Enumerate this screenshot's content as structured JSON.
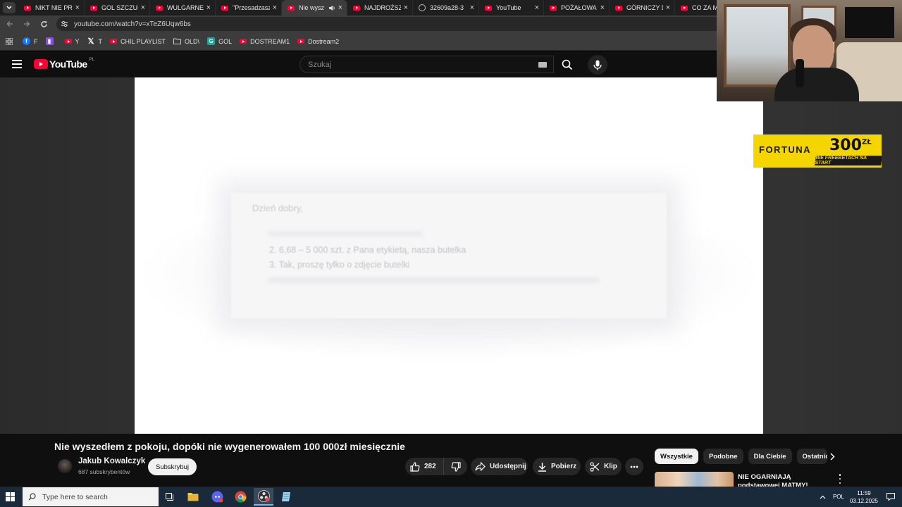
{
  "browser": {
    "tabs": [
      {
        "title": "NIKT NIE PRZ",
        "favicon": "youtube",
        "active": false
      },
      {
        "title": "GOL SZCZUR",
        "favicon": "youtube",
        "active": false
      },
      {
        "title": "WULGARNE",
        "favicon": "youtube",
        "active": false
      },
      {
        "title": "\"Przesadzasz",
        "favicon": "youtube",
        "active": false
      },
      {
        "title": "Nie wysz",
        "favicon": "youtube",
        "active": true
      },
      {
        "title": "NAJDROŻSZ",
        "favicon": "youtube",
        "active": false
      },
      {
        "title": "32609a28-3",
        "favicon": "globe",
        "active": false
      },
      {
        "title": "YouTube",
        "favicon": "youtube",
        "active": false
      },
      {
        "title": "POŻAŁOWA",
        "favicon": "youtube",
        "active": false
      },
      {
        "title": "GÓRNICZY D",
        "favicon": "youtube",
        "active": false
      },
      {
        "title": "CO ZA MEC",
        "favicon": "youtube",
        "active": false
      }
    ],
    "url": "youtube.com/watch?v=xTeZ6Uqw6bs",
    "bookmarks": [
      {
        "label": "F",
        "icon": "facebook-icon",
        "color": "#1877f2"
      },
      {
        "label": "",
        "icon": "twitch-icon",
        "color": "#9146ff"
      },
      {
        "label": "Y",
        "icon": "youtube-icon",
        "color": "#ff0033"
      },
      {
        "label": "T",
        "icon": "x-icon",
        "color": "#000000"
      },
      {
        "label": "CHIL PLAYLIST",
        "icon": "youtube-icon",
        "color": "#ff0033"
      },
      {
        "label": "OLD\\",
        "icon": "folder-icon",
        "color": "#cccccc"
      },
      {
        "label": "GOL",
        "icon": "g-icon",
        "color": "#1aa79a"
      },
      {
        "label": "DOSTREAM1",
        "icon": "youtube-icon",
        "color": "#ff0033"
      },
      {
        "label": "Dostream2",
        "icon": "youtube-icon",
        "color": "#ff0033"
      }
    ]
  },
  "youtube": {
    "logo_text": "YouTube",
    "country_code": "PL",
    "search_placeholder": "Szukaj"
  },
  "video_frame": {
    "greeting": "Dzień dobry,",
    "lines": [
      "2. 6,68 – 5 000 szt. z Pana etykietą, nasza butelka",
      "3. Tak, proszę tylko o zdjęcie butelki"
    ]
  },
  "ad": {
    "brand": "FORTUNA",
    "amount": "300",
    "currency": "ZŁ",
    "tagline": "WE FREEBETACH NA START"
  },
  "video": {
    "title": "Nie wyszedłem z pokoju, dopóki nie wygenerowałem 100 000zł miesięcznie",
    "channel": "Jakub Kowalczyk",
    "subscribers": "687 subskrybentów",
    "subscribe_label": "Subskrybuj",
    "likes": "282",
    "share_label": "Udostępnij",
    "download_label": "Pobierz",
    "clip_label": "Klip"
  },
  "recommendations": {
    "chips": [
      "Wszystkie",
      "Podobne",
      "Dla Ciebie",
      "Ostatnio"
    ],
    "first_title": "NIE OGARNIAJĄ podstawowej MATMY!"
  },
  "taskbar": {
    "search_placeholder": "Type here to search",
    "language": "POL",
    "time": "11:59",
    "date": "03.12.2025"
  }
}
